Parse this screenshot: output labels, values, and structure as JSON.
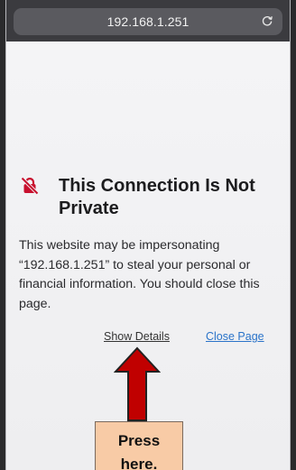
{
  "browser": {
    "url": "192.168.1.251",
    "reload_icon": "reload-icon"
  },
  "warning": {
    "icon": "lock-slash-icon",
    "icon_color": "#c8102e",
    "title": "This Connection Is Not Private",
    "message": "This website may be impersonating “192.168.1.251” to steal your personal or financial information. You should close this page.",
    "show_details_label": "Show Details",
    "close_page_label": "Close Page",
    "link_color": "#2a73c9"
  },
  "annotation": {
    "arrow_color": "#c00000",
    "callout_text": "Press\nhere.",
    "callout_color": "#f8cba6"
  }
}
